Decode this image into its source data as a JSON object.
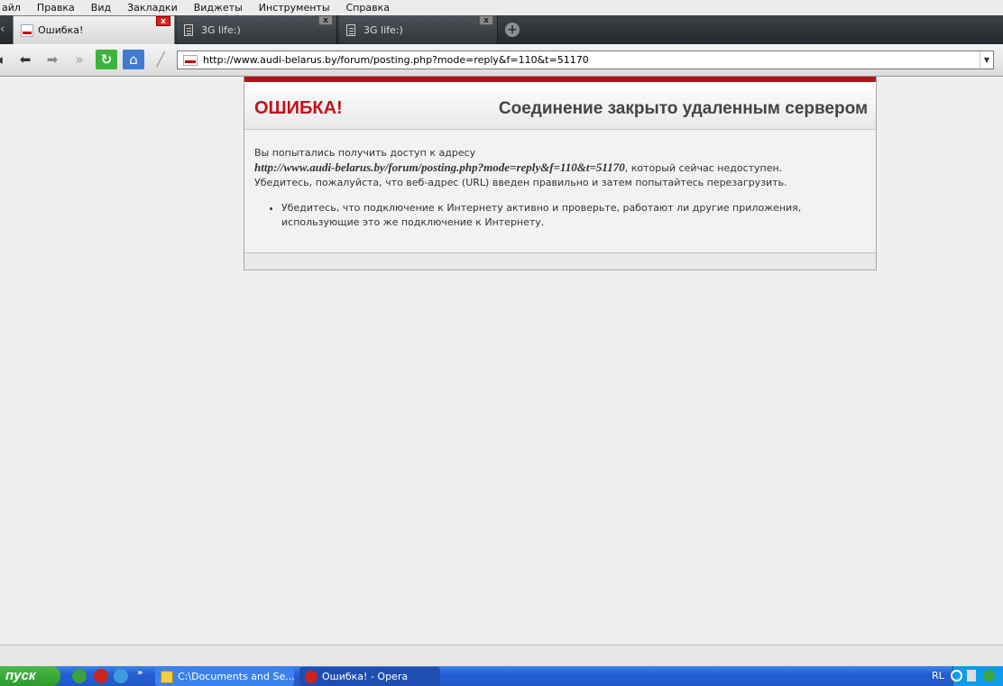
{
  "menu": [
    "айл",
    "Правка",
    "Вид",
    "Закладки",
    "Виджеты",
    "Инструменты",
    "Справка"
  ],
  "tabs": [
    {
      "label": "Ошибка!",
      "active": true,
      "close": "x",
      "icon": "audi-favicon-icon"
    },
    {
      "label": "3G life:)",
      "active": false,
      "close": "x",
      "icon": "page-icon"
    },
    {
      "label": "3G life:)",
      "active": false,
      "close": "x",
      "icon": "page-icon"
    }
  ],
  "toolbar": {
    "address": "http://www.audi-belarus.by/forum/posting.php?mode=reply&f=110&t=51170",
    "new_tab": "+"
  },
  "error": {
    "title": "ОШИБКА!",
    "subtitle": "Соединение закрыто удаленным сервером",
    "line1": "Вы попытались получить доступ к адресу",
    "url": "http://www.audi-belarus.by/forum/posting.php?mode=reply&f=110&t=51170",
    "line2_suffix": ", который сейчас недоступен.",
    "line3": "Убедитесь, пожалуйста, что веб-адрес (URL) введен правильно и затем попытайтесь перезагрузить.",
    "bullet": "Убедитесь, что подключение к Интернету активно и проверьте, работают ли другие приложения, использующие это же подключение к Интернету."
  },
  "taskbar": {
    "start": "пуск",
    "tasks": [
      {
        "label": "C:\\Documents and Se..."
      },
      {
        "label": "Ошибка! - Opera"
      }
    ],
    "lang": "RL"
  },
  "colors": {
    "error_red": "#c0121a",
    "taskbar_blue": "#245fd4",
    "start_green": "#3aa83a"
  }
}
